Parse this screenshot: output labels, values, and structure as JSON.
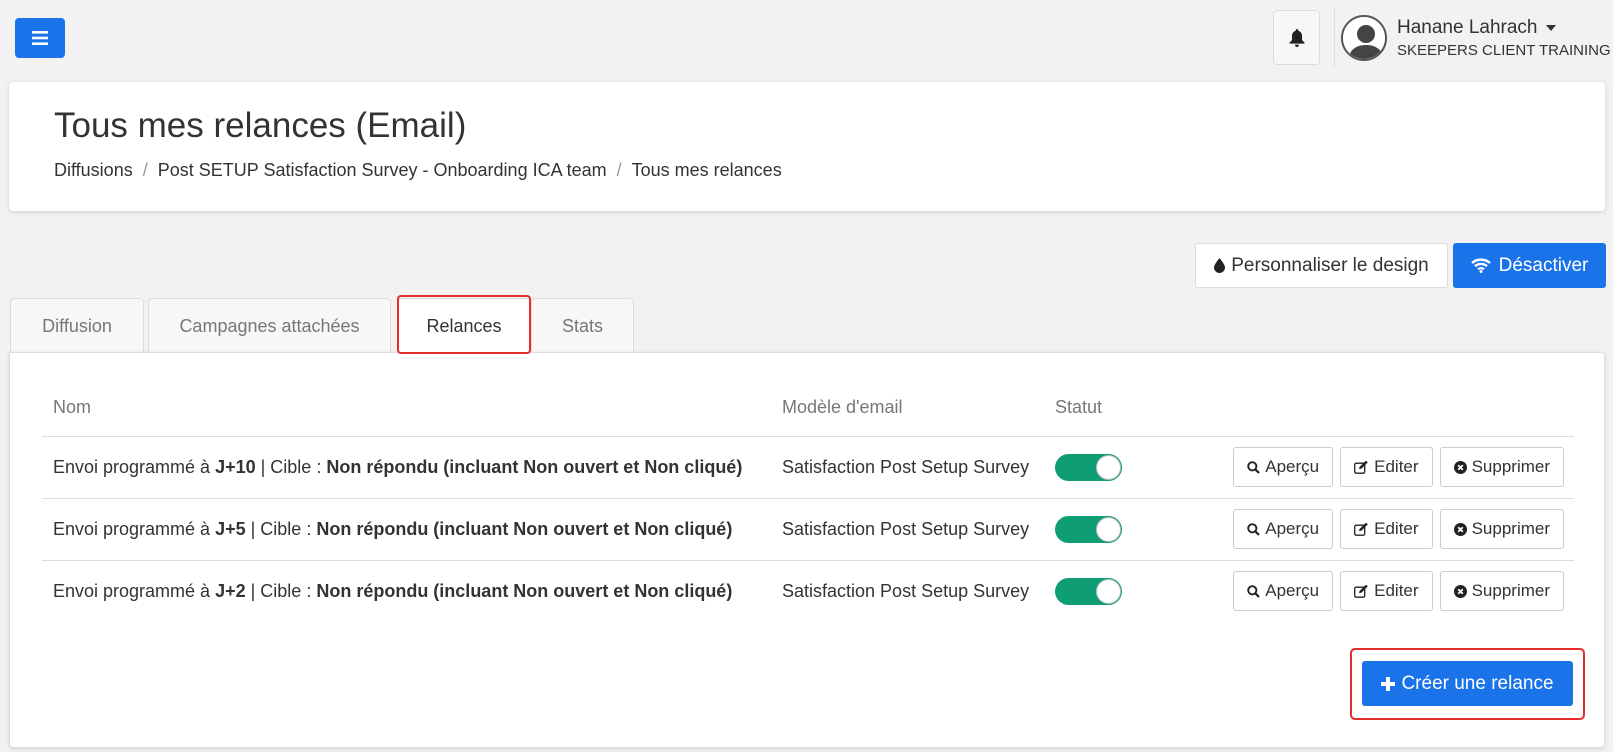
{
  "topbar": {
    "menu_icon": "hamburger-icon",
    "bell_icon": "bell-icon",
    "user_name": "Hanane Lahrach",
    "user_org": "SKEEPERS CLIENT TRAINING"
  },
  "header": {
    "title": "Tous mes relances (Email)",
    "breadcrumb": [
      "Diffusions",
      "Post SETUP Satisfaction Survey - Onboarding ICA team",
      "Tous mes relances"
    ]
  },
  "actions": {
    "design_label": "Personnaliser le design",
    "design_icon": "tint-icon",
    "deactivate_label": "Désactiver",
    "deactivate_icon": "wifi-icon"
  },
  "tabs": [
    {
      "label": "Diffusion"
    },
    {
      "label": "Campagnes attachées"
    },
    {
      "label": "Relances",
      "active": true
    },
    {
      "label": "Stats"
    }
  ],
  "table": {
    "headers": {
      "name": "Nom",
      "model": "Modèle d'email",
      "status": "Statut"
    },
    "rows": [
      {
        "prefix": "Envoi programmé à ",
        "day": "J+10",
        "mid": " | Cible : ",
        "target": "Non répondu (incluant Non ouvert et Non cliqué)",
        "model": "Satisfaction Post Setup Survey",
        "status_on": true
      },
      {
        "prefix": "Envoi programmé à ",
        "day": "J+5",
        "mid": " | Cible : ",
        "target": "Non répondu (incluant Non ouvert et Non cliqué)",
        "model": "Satisfaction Post Setup Survey",
        "status_on": true
      },
      {
        "prefix": "Envoi programmé à ",
        "day": "J+2",
        "mid": " | Cible : ",
        "target": "Non répondu (incluant Non ouvert et Non cliqué)",
        "model": "Satisfaction Post Setup Survey",
        "status_on": true
      }
    ],
    "row_actions": {
      "preview": "Aperçu",
      "edit": "Editer",
      "delete": "Supprimer"
    }
  },
  "create_button": {
    "label": "Créer une relance",
    "icon": "plus-icon"
  },
  "colors": {
    "primary": "#1a73e8",
    "toggle_on": "#0f9d74",
    "highlight": "#e52d2d"
  }
}
